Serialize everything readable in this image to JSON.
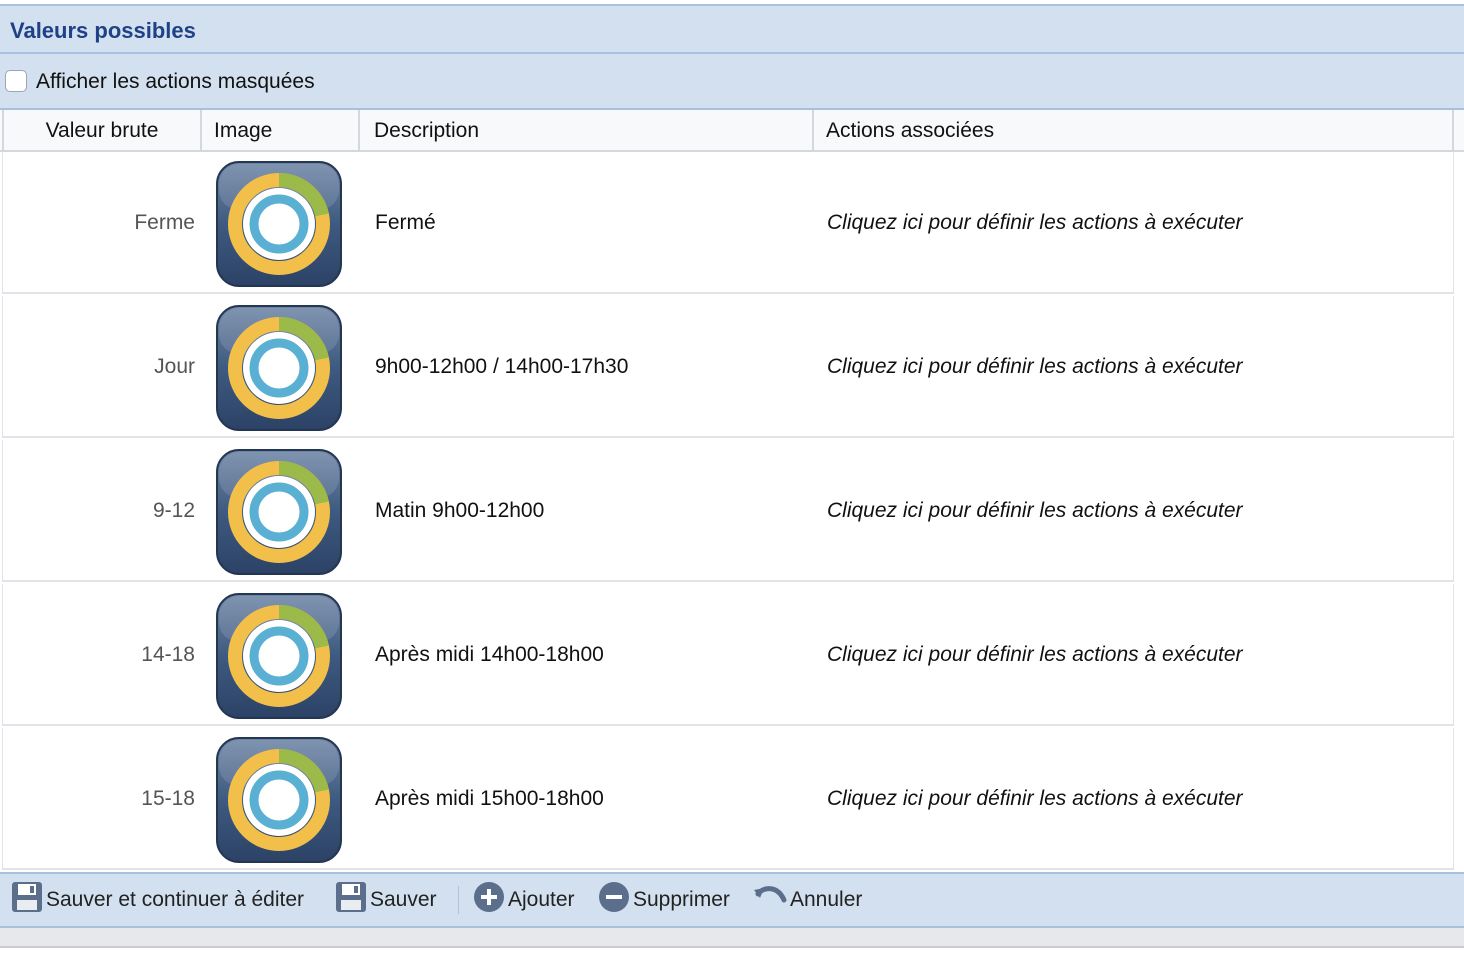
{
  "panel": {
    "title": "Valeurs possibles"
  },
  "options": {
    "show_hidden_label": "Afficher les actions masquées",
    "show_hidden_checked": false
  },
  "table": {
    "columns": [
      "Valeur brute",
      "Image",
      "Description",
      "Actions associées"
    ],
    "rows": [
      {
        "value": "Ferme",
        "image_icon": "round-timer-icon",
        "description": "Fermé",
        "actions": "Cliquez ici pour définir les actions à exécuter"
      },
      {
        "value": "Jour",
        "image_icon": "round-timer-icon",
        "description": "9h00-12h00 / 14h00-17h30",
        "actions": "Cliquez ici pour définir les actions à exécuter"
      },
      {
        "value": "9-12",
        "image_icon": "round-timer-icon",
        "description": "Matin 9h00-12h00",
        "actions": "Cliquez ici pour définir les actions à exécuter"
      },
      {
        "value": "14-18",
        "image_icon": "round-timer-icon",
        "description": "Après midi 14h00-18h00",
        "actions": "Cliquez ici pour définir les actions à exécuter"
      },
      {
        "value": "15-18",
        "image_icon": "round-timer-icon",
        "description": "Après midi 15h00-18h00",
        "actions": "Cliquez ici pour définir les actions à exécuter"
      }
    ]
  },
  "toolbar": {
    "save_continue_label": "Sauver et continuer à éditer",
    "save_label": "Sauver",
    "add_label": "Ajouter",
    "delete_label": "Supprimer",
    "cancel_label": "Annuler"
  },
  "colors": {
    "header_bg": "#d3e0ef",
    "title": "#1f4185",
    "icon_bg": "#3e5a80",
    "icon_yellow": "#f2c04a",
    "icon_green": "#9cba4a",
    "icon_blue": "#5ab0d3"
  }
}
